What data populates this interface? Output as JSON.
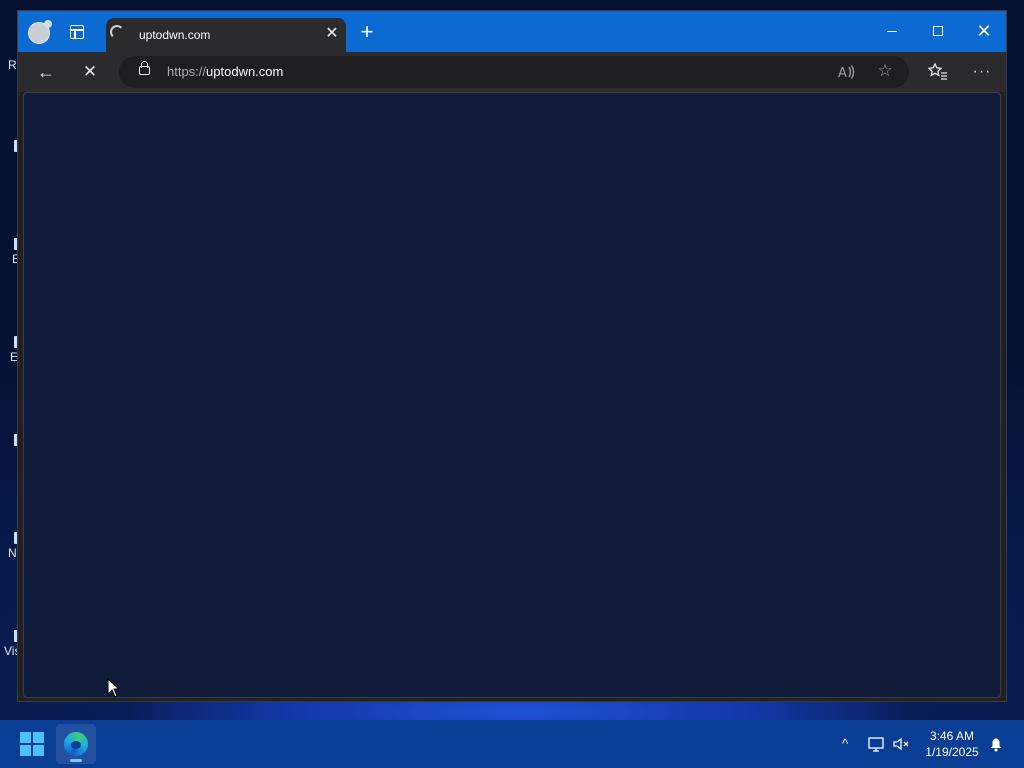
{
  "desktop": {
    "icons": [
      {
        "label": "R"
      },
      {
        "label": ""
      },
      {
        "label": "E"
      },
      {
        "label": "E"
      },
      {
        "label": ""
      },
      {
        "label": "N"
      },
      {
        "label": "Vis"
      }
    ]
  },
  "browser": {
    "tab": {
      "title": "uptodwn.com",
      "close_symbol": "✕"
    },
    "new_tab_symbol": "+",
    "window_controls": {
      "close_symbol": "✕"
    },
    "toolbar": {
      "back_symbol": "←",
      "stop_symbol": "✕",
      "more_symbol": "···"
    },
    "address": {
      "scheme": "https://",
      "host": "uptodwn.com"
    }
  },
  "taskbar": {
    "chevron_symbol": "^",
    "clock": {
      "time": "3:46 AM",
      "date": "1/19/2025"
    }
  },
  "colors": {
    "titlebar": "#0b6bd3",
    "toolbar": "#2b2b2e",
    "content": "#0f1b38",
    "taskbar": "#0a3e95"
  }
}
